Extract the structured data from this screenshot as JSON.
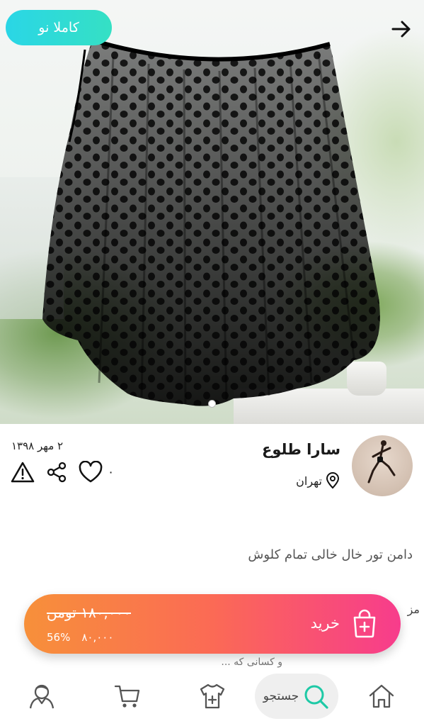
{
  "listing": {
    "badge": "کاملا نو",
    "title": "دامن تور خال خالی تمام کلوش",
    "likes": "۰",
    "date": "۲ مهر ۱۳۹۸"
  },
  "seller": {
    "name": "سارا طلوع",
    "location": "تهران"
  },
  "purchase": {
    "label": "خرید",
    "old_price": "۱۸۰,۰۰۰ تومن",
    "price": "۸۰,۰۰۰",
    "discount": "56%"
  },
  "description_peek": {
    "line1": "مز",
    "line2": "و کسانی که ..."
  },
  "nav": {
    "search_label": "جستجو"
  },
  "icons": [
    "arrow-right-icon",
    "map-pin-icon",
    "heart-icon",
    "share-icon",
    "warning-icon",
    "shopping-bag-icon",
    "home-icon",
    "search-icon",
    "shirt-add-icon",
    "cart-icon",
    "user-icon"
  ],
  "colors": {
    "badge_gradient": [
      "#2ad6e6",
      "#35e0c4"
    ],
    "buy_gradient": [
      "#f7903a",
      "#fb6a55",
      "#f73c8c"
    ],
    "search_accent": "#1ec9a6"
  }
}
